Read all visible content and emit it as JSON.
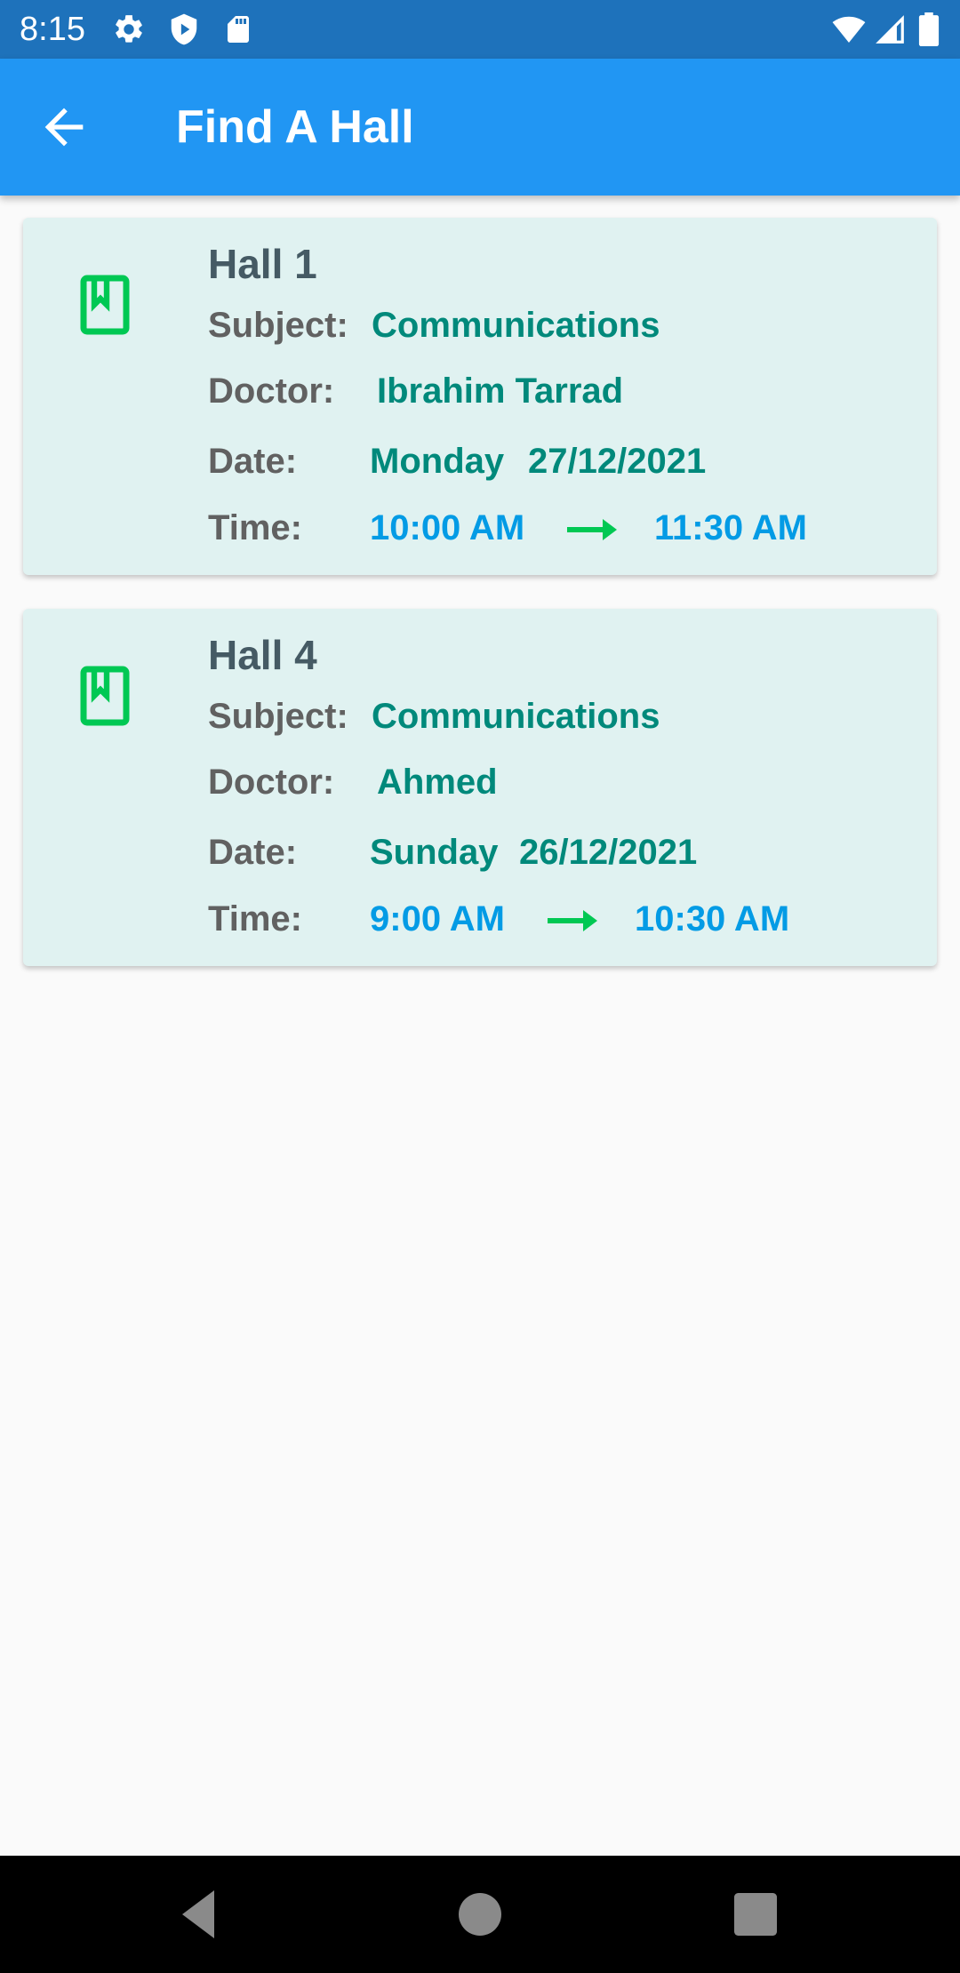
{
  "status_bar": {
    "time": "8:15"
  },
  "app_bar": {
    "title": "Find A Hall",
    "back_icon": "arrow-back-icon"
  },
  "colors": {
    "status_bar": "#1e72bb",
    "app_bar": "#2196f3",
    "card_background": "#e0f2f1",
    "hall_name": "#455a64",
    "label": "#616161",
    "value": "#00897b",
    "time": "#039be5",
    "icon_green": "#00c853"
  },
  "labels": {
    "subject": "Subject:",
    "doctor": "Doctor:",
    "date": "Date:",
    "time": "Time:"
  },
  "halls": [
    {
      "name": "Hall 1",
      "subject": "Communications",
      "doctor": "Ibrahim Tarrad",
      "day": "Monday",
      "date": "27/12/2021",
      "start_time": "10:00 AM",
      "end_time": "11:30 AM",
      "icon": "book-bookmark-icon"
    },
    {
      "name": "Hall 4",
      "subject": "Communications",
      "doctor": "Ahmed",
      "day": "Sunday",
      "date": "26/12/2021",
      "start_time": "9:00 AM",
      "end_time": "10:30 AM",
      "icon": "book-bookmark-icon"
    }
  ]
}
